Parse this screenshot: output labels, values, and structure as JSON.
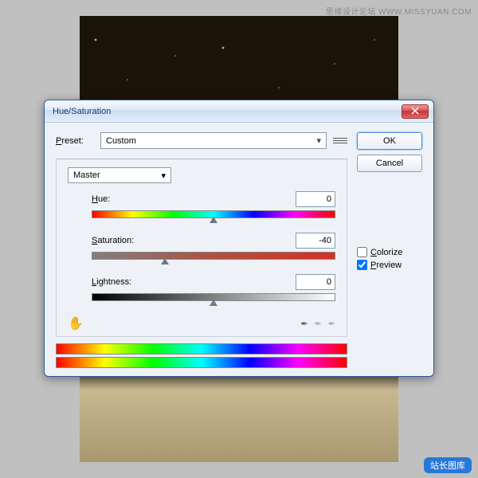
{
  "watermarks": {
    "top": "思缘设计论坛  WWW.MISSYUAN.COM",
    "bottom": "站长图库"
  },
  "dialog": {
    "title": "Hue/Saturation",
    "buttons": {
      "ok": "OK",
      "cancel": "Cancel"
    },
    "preset": {
      "label": "Preset:",
      "value": "Custom"
    },
    "channel": {
      "value": "Master"
    },
    "sliders": {
      "hue": {
        "label": "Hue:",
        "value": "0",
        "pos": 50
      },
      "saturation": {
        "label": "Saturation:",
        "value": "-40",
        "pos": 30
      },
      "lightness": {
        "label": "Lightness:",
        "value": "0",
        "pos": 50
      }
    },
    "options": {
      "colorize": "Colorize",
      "preview": "Preview",
      "preview_checked": true
    }
  }
}
